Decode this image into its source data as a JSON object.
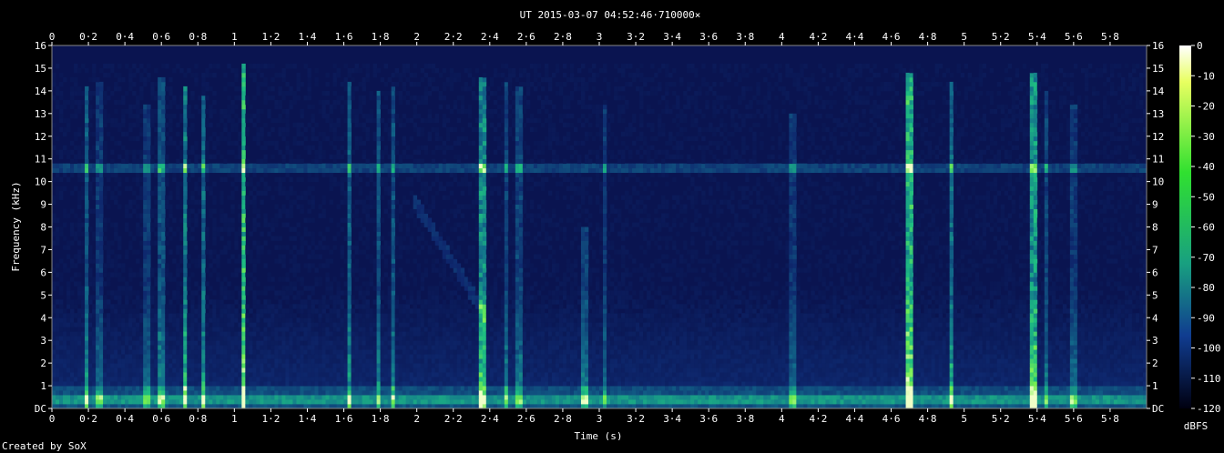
{
  "title": "UT 2015-03-07 04:52:46·710000×",
  "credit": "Created by SoX",
  "chart_data": {
    "type": "heatmap",
    "title": "UT 2015-03-07 04:52:46·710000×",
    "xlabel": "Time (s)",
    "ylabel": "Frequency (kHz)",
    "xlim": [
      0,
      6
    ],
    "ylim": [
      0,
      16
    ],
    "x_ticks": [
      "0",
      "0·2",
      "0·4",
      "0·6",
      "0·8",
      "1",
      "1·2",
      "1·4",
      "1·6",
      "1·8",
      "2",
      "2·2",
      "2·4",
      "2·6",
      "2·8",
      "3",
      "3·2",
      "3·4",
      "3·6",
      "3·8",
      "4",
      "4·2",
      "4·4",
      "4·6",
      "4·8",
      "5",
      "5·2",
      "5·4",
      "5·6",
      "5·8"
    ],
    "y_ticks": [
      "DC",
      "1",
      "2",
      "3",
      "4",
      "5",
      "6",
      "7",
      "8",
      "9",
      "10",
      "11",
      "12",
      "13",
      "14",
      "15",
      "16"
    ],
    "colorbar": {
      "label": "dBFS",
      "ticks": [
        "0",
        "-10",
        "-20",
        "-30",
        "-40",
        "-50",
        "-60",
        "-70",
        "-80",
        "-90",
        "-100",
        "-110",
        "-120"
      ],
      "range": [
        -120,
        0
      ]
    },
    "features": {
      "steady_tone_khz": 10.6,
      "low_band_khz": [
        0.3,
        0.7
      ],
      "transients": [
        {
          "t": 0.19,
          "f_top": 14.2,
          "level": 0.45
        },
        {
          "t": 0.26,
          "f_top": 14.5,
          "level": 0.3
        },
        {
          "t": 0.52,
          "f_top": 13.5,
          "level": 0.3
        },
        {
          "t": 0.6,
          "f_top": 14.6,
          "level": 0.4
        },
        {
          "t": 0.73,
          "f_top": 14.3,
          "level": 0.55
        },
        {
          "t": 0.83,
          "f_top": 13.9,
          "level": 0.5
        },
        {
          "t": 1.05,
          "f_top": 15.2,
          "level": 0.75
        },
        {
          "t": 1.63,
          "f_top": 14.4,
          "level": 0.45
        },
        {
          "t": 1.79,
          "f_top": 14.0,
          "level": 0.4
        },
        {
          "t": 1.87,
          "f_top": 14.3,
          "level": 0.4
        },
        {
          "t": 2.36,
          "f_top": 14.6,
          "level": 0.6
        },
        {
          "t": 2.49,
          "f_top": 14.5,
          "level": 0.35
        },
        {
          "t": 2.56,
          "f_top": 14.2,
          "level": 0.35
        },
        {
          "t": 2.92,
          "f_top": 8.0,
          "level": 0.35
        },
        {
          "t": 3.03,
          "f_top": 13.5,
          "level": 0.3
        },
        {
          "t": 4.06,
          "f_top": 13.0,
          "level": 0.3
        },
        {
          "t": 4.7,
          "f_top": 14.8,
          "level": 0.75
        },
        {
          "t": 4.93,
          "f_top": 14.5,
          "level": 0.5
        },
        {
          "t": 5.38,
          "f_top": 14.9,
          "level": 0.65
        },
        {
          "t": 5.45,
          "f_top": 14.0,
          "level": 0.35
        },
        {
          "t": 5.6,
          "f_top": 13.5,
          "level": 0.3
        }
      ],
      "sweep": {
        "t_start": 1.98,
        "f_start": 9.2,
        "t_end": 2.38,
        "f_end": 4.1
      }
    }
  }
}
